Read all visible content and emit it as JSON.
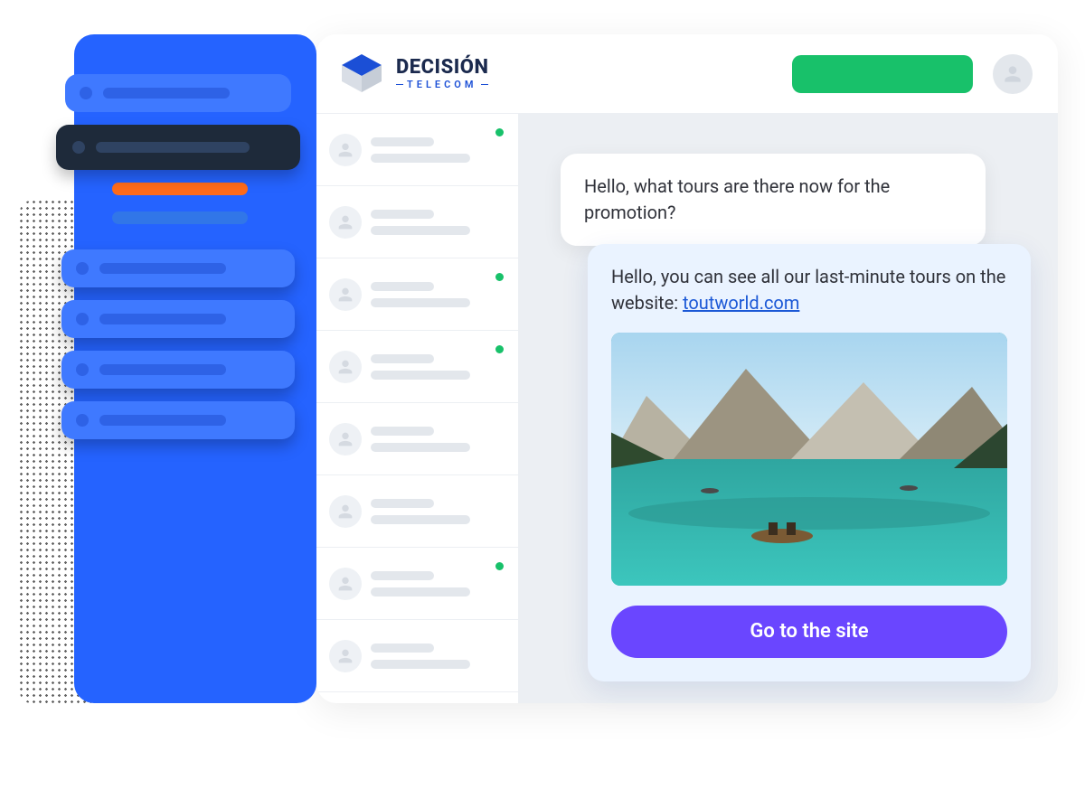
{
  "brand": {
    "name_top": "DECISIÓN",
    "name_bottom": "TELECOM"
  },
  "header": {
    "primary_button_color": "#18c16a"
  },
  "conversations": [
    {
      "online": true
    },
    {
      "online": false
    },
    {
      "online": true
    },
    {
      "online": true
    },
    {
      "online": false
    },
    {
      "online": false
    },
    {
      "online": true
    },
    {
      "online": false
    }
  ],
  "sidebar": {
    "top_items": [
      {
        "active": false
      },
      {
        "active": true
      }
    ],
    "pills": [
      {
        "color": "orange"
      },
      {
        "color": "blue"
      }
    ],
    "stack_items": [
      {},
      {},
      {},
      {}
    ]
  },
  "chat": {
    "user_message": "Hello, what tours are there now for the promotion?",
    "agent_message_prefix": "Hello, you can see all our last-minute tours on the website: ",
    "agent_link_text": "toutworld.com",
    "cta_label": "Go to the site"
  }
}
